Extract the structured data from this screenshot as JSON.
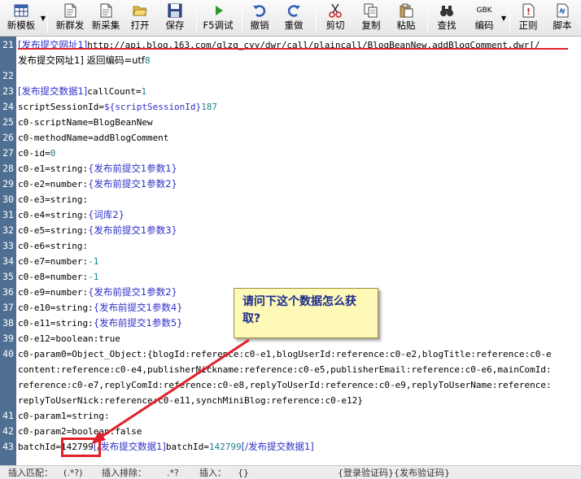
{
  "toolbar": {
    "items": [
      {
        "label": "新模板",
        "icon": "table-icon"
      },
      {
        "label": "新群发",
        "icon": "new-doc-icon"
      },
      {
        "label": "新采集",
        "icon": "new-doc-icon"
      },
      {
        "label": "打开",
        "icon": "folder-open-icon"
      },
      {
        "label": "保存",
        "icon": "floppy-icon"
      },
      {
        "label": "F5调试",
        "icon": "play-icon"
      },
      {
        "label": "撤销",
        "icon": "undo-icon"
      },
      {
        "label": "重做",
        "icon": "redo-icon"
      },
      {
        "label": "剪切",
        "icon": "scissors-icon"
      },
      {
        "label": "复制",
        "icon": "copy-icon"
      },
      {
        "label": "粘贴",
        "icon": "paste-icon"
      },
      {
        "label": "查找",
        "icon": "binoculars-icon"
      },
      {
        "label": "编码",
        "icon_text": "GBK",
        "icon": "encoding-icon"
      },
      {
        "label": "正则",
        "icon": "regex-icon"
      },
      {
        "label": "脚本",
        "icon": "script-icon"
      }
    ]
  },
  "editor": {
    "lines": [
      {
        "n": "21",
        "text": "[发布提交网址1]http://api.blog.163.com/qlzq_cyy/dwr/call/plaincall/BlogBeanNew.addBlogComment.dwr[/"
      },
      {
        "n": "",
        "text": "发布提交网址1] 返回编码=utf8"
      },
      {
        "n": "22",
        "text": ""
      },
      {
        "n": "23",
        "text": "[发布提交数据1]callCount=1"
      },
      {
        "n": "24",
        "text": "scriptSessionId=${scriptSessionId}187"
      },
      {
        "n": "25",
        "text": "c0-scriptName=BlogBeanNew"
      },
      {
        "n": "26",
        "text": "c0-methodName=addBlogComment"
      },
      {
        "n": "27",
        "text": "c0-id=0"
      },
      {
        "n": "28",
        "text": "c0-e1=string:{发布前提交1参数1}"
      },
      {
        "n": "29",
        "text": "c0-e2=number:{发布前提交1参数2}"
      },
      {
        "n": "30",
        "text": "c0-e3=string:"
      },
      {
        "n": "31",
        "text": "c0-e4=string:{词库2}"
      },
      {
        "n": "32",
        "text": "c0-e5=string:{发布前提交1参数3}"
      },
      {
        "n": "33",
        "text": "c0-e6=string:"
      },
      {
        "n": "34",
        "text": "c0-e7=number:-1"
      },
      {
        "n": "35",
        "text": "c0-e8=number:-1"
      },
      {
        "n": "36",
        "text": "c0-e9=number:{发布前提交1参数2}"
      },
      {
        "n": "37",
        "text": "c0-e10=string:{发布前提交1参数4}"
      },
      {
        "n": "38",
        "text": "c0-e11=string:{发布前提交1参数5}"
      },
      {
        "n": "39",
        "text": "c0-e12=boolean:true"
      },
      {
        "n": "40",
        "text": "c0-param0=Object_Object:{blogId:reference:c0-e1,blogUserId:reference:c0-e2,blogTitle:reference:c0-e"
      },
      {
        "n": "",
        "text": "content:reference:c0-e4,publisherNickname:reference:c0-e5,publisherEmail:reference:c0-e6,mainComId:"
      },
      {
        "n": "",
        "text": "reference:c0-e7,replyComId:reference:c0-e8,replyToUserId:reference:c0-e9,replyToUserName:reference:"
      },
      {
        "n": "",
        "text": "replyToUserNick:reference:c0-e11,synchMiniBlog:reference:c0-e12}"
      },
      {
        "n": "41",
        "text": "c0-param1=string:"
      },
      {
        "n": "42",
        "text": "c0-param2=boolean:false"
      },
      {
        "n": "43",
        "text": "batchId=142799[/发布提交数据1]"
      }
    ]
  },
  "annotation": {
    "callout_text": "请问下这个数据怎么获取?"
  },
  "statusbar": {
    "insert_match_label": "插入匹配：",
    "insert_match_value": "(.*?)",
    "insert_exclude_label": "插入排除：",
    "insert_exclude_value": ".*?",
    "insert_label": "插入：",
    "insert_value": "{}",
    "tags": "{登录验证码}{发布验证码}"
  },
  "colors": {
    "gutter": "#4f6f92",
    "tag": "#3030c8",
    "number": "#1a7f8e",
    "annotation_red": "#e0202a",
    "callout_bg": "#fff9b8"
  }
}
